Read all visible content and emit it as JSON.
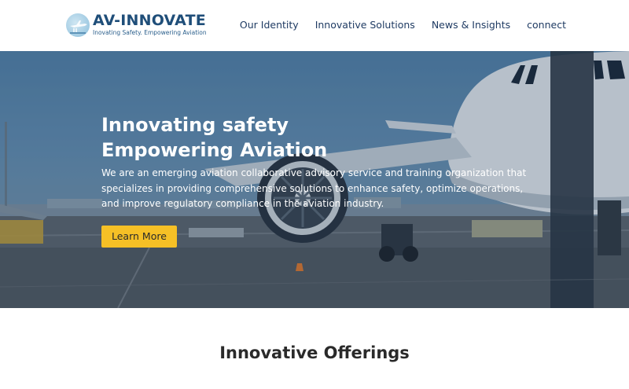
{
  "header": {
    "logo_title": "AV-INNOVATE",
    "logo_tagline": "Inovating Safety. Empowering Aviation",
    "nav": [
      {
        "label": "Our Identity"
      },
      {
        "label": "Innovative Solutions"
      },
      {
        "label": "News & Insights"
      },
      {
        "label": "connect"
      }
    ]
  },
  "hero": {
    "heading_line1": "Innovating safety",
    "heading_line2": "Empowering Aviation",
    "description": "We are an emerging aviation collaborative advisory service and training organization that specializes in providing comprehensive solutions to enhance safety, optimize operations, and improve regulatory compliance in the aviation industry.",
    "cta_label": "Learn More"
  },
  "offerings": {
    "title": "Innovative Offerings"
  },
  "colors": {
    "brand_blue": "#1f4e79",
    "nav_text": "#1f3b63",
    "cta_yellow": "#f6c026"
  },
  "icons": {
    "logo": "airplane-logo-icon"
  }
}
